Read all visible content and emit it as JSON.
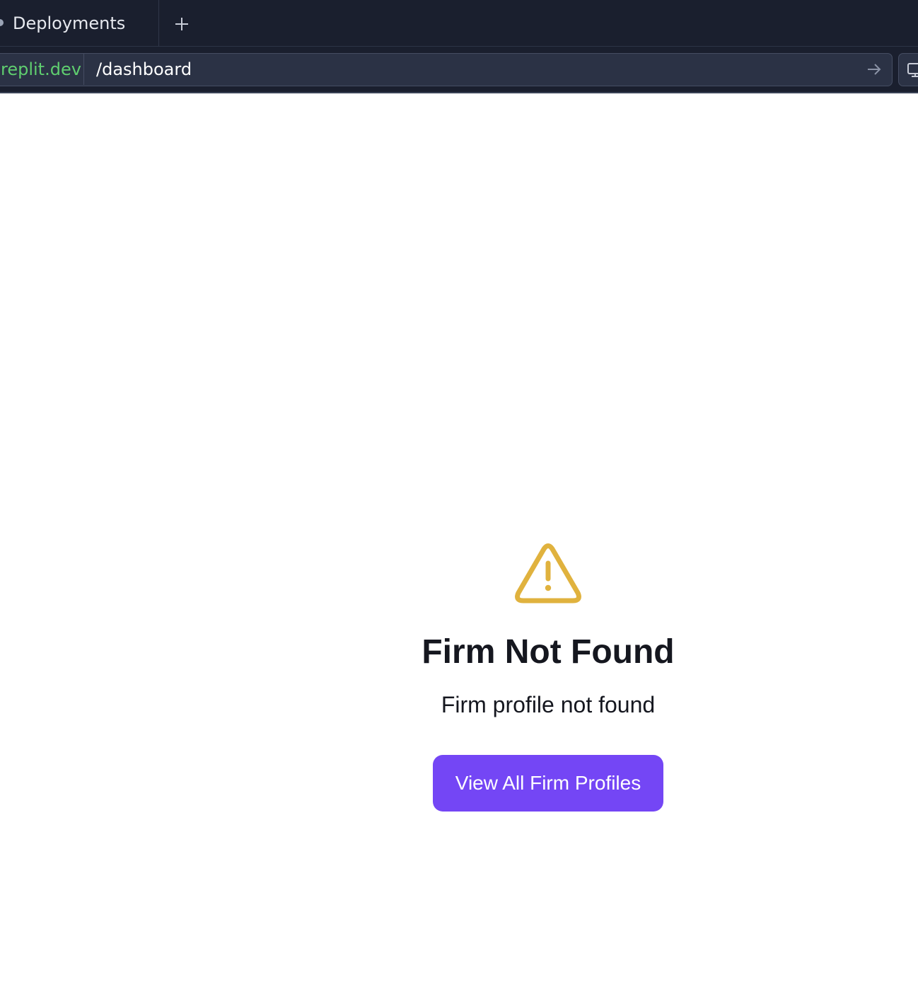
{
  "browser": {
    "tab": {
      "label": "Deployments",
      "icon": "tab-dot-icon"
    },
    "new_tab_icon": "plus-icon",
    "address": {
      "domain": "replit.dev",
      "path": "/dashboard",
      "go_icon": "arrow-right-icon"
    },
    "device_icon": "monitor-icon"
  },
  "page": {
    "icon": "warning-triangle-icon",
    "title": "Firm Not Found",
    "message": "Firm profile not found",
    "button_label": "View All Firm Profiles"
  },
  "colors": {
    "chrome_bg": "#1a1f2e",
    "url_bg": "#2b3245",
    "domain_green": "#5fce6f",
    "warning_amber": "#e0b23e",
    "button_purple": "#7446f5",
    "text_dark": "#15171f"
  }
}
